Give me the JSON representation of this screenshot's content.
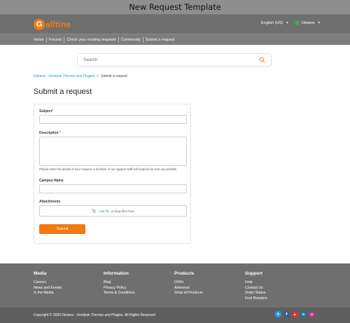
{
  "window": {
    "title": "New Request Template"
  },
  "header": {
    "logo_text": "alltine",
    "logo_letter": "G",
    "language": "English (US)",
    "user_name": "Diziana"
  },
  "nav": [
    "Home",
    "Forums",
    "Check your existing requests",
    "Community",
    "Submit a request"
  ],
  "search": {
    "placeholder": "Search"
  },
  "breadcrumb": {
    "parent": "Diziana - Zendesk Themes and Plugins",
    "separator": ">",
    "current": "Submit a request"
  },
  "page": {
    "title": "Submit a request"
  },
  "form": {
    "subject_label": "Subject",
    "description_label": "Description",
    "required_marker": "*",
    "helper_text": "Please enter the details of your request. A member of our support staff will respond as soon as possible.",
    "campus_label": "Campus Name",
    "attachments_label": "Attachments",
    "add_file": "Add file",
    "drop_text": "or drop files here",
    "submit_label": "Submit"
  },
  "footer": {
    "columns": [
      {
        "heading": "Media",
        "links": [
          "Careers",
          "News and Events",
          "In the Media"
        ]
      },
      {
        "heading": "Information",
        "links": [
          "Blog",
          "Privacy Policy",
          "Terms & Conditions"
        ]
      },
      {
        "heading": "Products",
        "links": [
          "DVR+",
          "Antennas",
          "Shop all Products"
        ]
      },
      {
        "heading": "Support",
        "links": [
          "Help",
          "Contact Us",
          "Order Status",
          "Find Retailers"
        ]
      }
    ],
    "copyright": "Copyright © 2020 Diziana - Zendesk Themes and Plugins. All Rights Reserved"
  },
  "socials": [
    {
      "name": "twitter-icon",
      "glyph": "t",
      "color": "#1da1f2"
    },
    {
      "name": "facebook-icon",
      "glyph": "f",
      "color": "#3b5998"
    },
    {
      "name": "youtube-icon",
      "glyph": "▶",
      "color": "#e52d27"
    },
    {
      "name": "linkedin-icon",
      "glyph": "in",
      "color": "#0e76a8"
    },
    {
      "name": "instagram-icon",
      "glyph": "◎",
      "color": "#c13584"
    }
  ],
  "colors": {
    "accent": "#f27a10",
    "link": "#2a9bd6",
    "header_bg": "#6f6f6f"
  }
}
